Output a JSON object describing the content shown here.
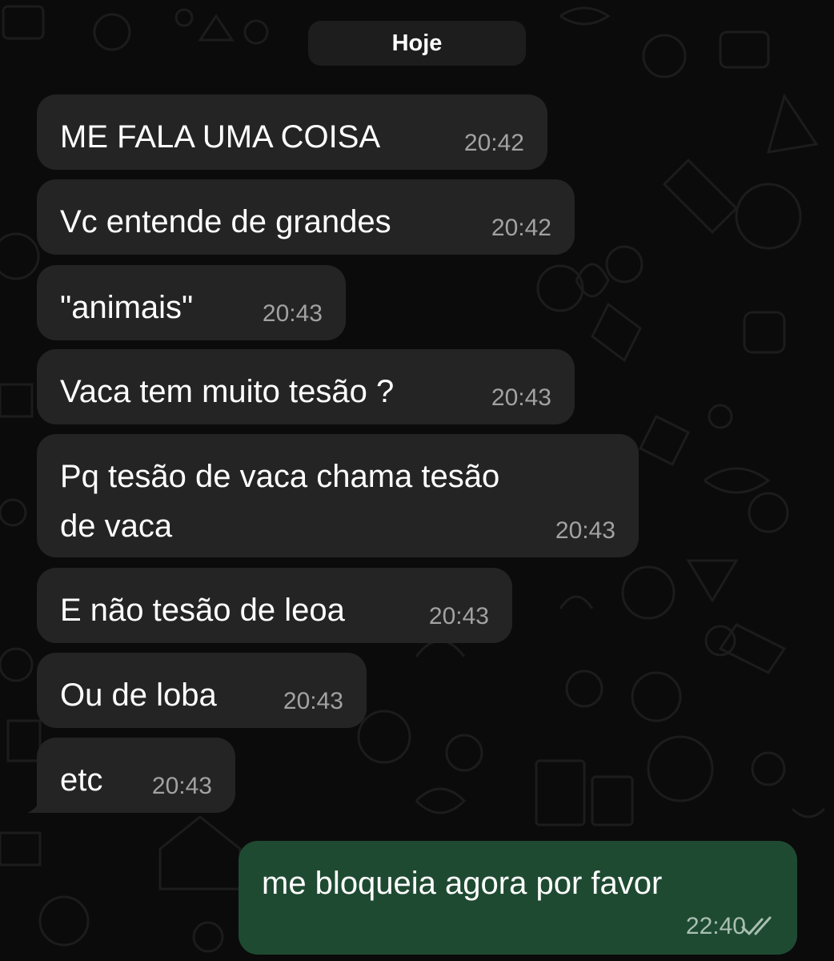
{
  "date_label": "Hoje",
  "incoming": [
    {
      "text": "ME FALA UMA COISA",
      "time": "20:42"
    },
    {
      "text": "Vc entende de grandes",
      "time": "20:42"
    },
    {
      "text": "\"animais\"",
      "time": "20:43"
    },
    {
      "text": "Vaca tem muito tesão ?",
      "time": "20:43"
    },
    {
      "text_line1": "Pq tesão de vaca chama tesão",
      "text_line2": "de vaca",
      "time": "20:43"
    },
    {
      "text": "E não tesão de leoa",
      "time": "20:43"
    },
    {
      "text": "Ou de loba",
      "time": "20:43"
    },
    {
      "text": "etc",
      "time": "20:43"
    }
  ],
  "outgoing": [
    {
      "text": "me bloqueia agora por favor",
      "time": "22:40",
      "status_icon": "double-check-read-icon"
    }
  ],
  "colors": {
    "background": "#0b0b0b",
    "incoming_bubble": "#242424",
    "outgoing_bubble": "#1f4a32",
    "timestamp": "#a2a2a2"
  }
}
